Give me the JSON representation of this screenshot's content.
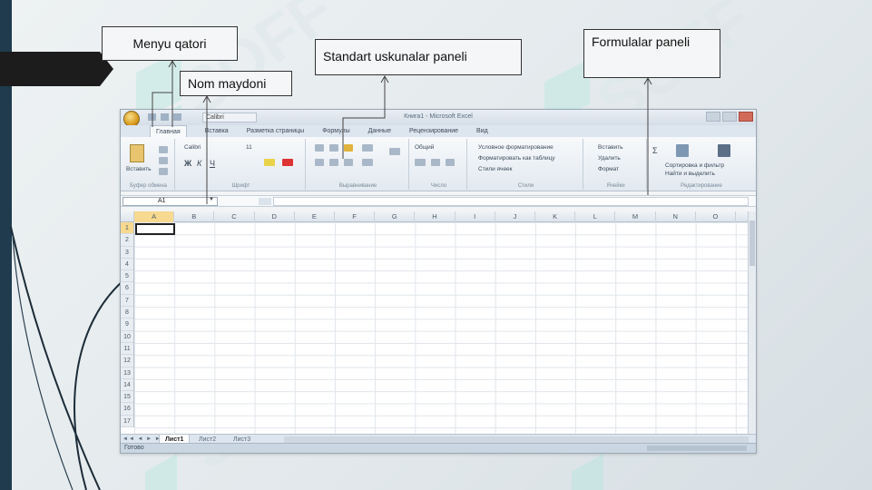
{
  "callouts": {
    "menu": "Menyu qatori",
    "namebox": "Nom maydoni",
    "standard": "Standart uskunalar  paneli",
    "formula": "Formulalar paneli"
  },
  "excel": {
    "window_title": "Книга1 - Microsoft Excel",
    "qat_font": "Calibri",
    "tabs": [
      "Главная",
      "Вставка",
      "Разметка страницы",
      "Формулы",
      "Данные",
      "Рецензирование",
      "Вид"
    ],
    "ribbon": {
      "paste": "Вставить",
      "font_name": "Calibri",
      "font_size": "11",
      "number_format": "Общий",
      "styles": [
        "Условное форматирование",
        "Форматировать как таблицу",
        "Стили ячеек"
      ],
      "cells": [
        "Вставить",
        "Удалить",
        "Формат"
      ],
      "editing": [
        "Сортировка и фильтр",
        "Найти и выделить"
      ],
      "groups": [
        "Буфер обмена",
        "Шрифт",
        "Выравнивание",
        "Число",
        "Стили",
        "Ячейки",
        "Редактирование"
      ]
    },
    "name_box": "A1",
    "columns": [
      "A",
      "B",
      "C",
      "D",
      "E",
      "F",
      "G",
      "H",
      "I",
      "J",
      "K",
      "L",
      "M",
      "N",
      "O"
    ],
    "rows": [
      "1",
      "2",
      "3",
      "4",
      "5",
      "6",
      "7",
      "8",
      "9",
      "10",
      "11",
      "12",
      "13",
      "14",
      "15",
      "16",
      "17"
    ],
    "sheets": [
      "Лист1",
      "Лист2",
      "Лист3"
    ],
    "status": "Готово",
    "nav_arrows": "◄◄ ◄ ► ►►"
  }
}
